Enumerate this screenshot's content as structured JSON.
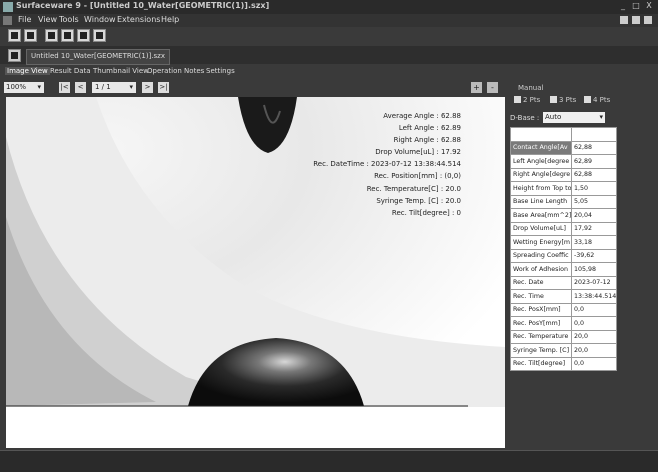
{
  "window": {
    "title": "Surfaceware 9 - [Untitled 10_Water[GEOMETRIC(1)].szx]",
    "min": "_",
    "max": "□",
    "close": "X"
  },
  "menu": [
    "File",
    "View",
    "Tools",
    "Window",
    "Extensions",
    "Help"
  ],
  "document_tab": "Untitled 10_Water[GEOMETRIC(1)].szx",
  "view_tabs": [
    "Image View",
    "Result Data",
    "Thumbnail View",
    "Operation Notes",
    "Settings"
  ],
  "nav": {
    "zoom": "100%",
    "first": "|<",
    "prev": "<",
    "page": "1 / 1",
    "next": ">",
    "last": ">|",
    "zoom_in": "+",
    "zoom_out": "-"
  },
  "overlay": [
    "Average Angle : 62.88",
    "Left Angle : 62.89",
    "Right Angle : 62.88",
    "Drop Volume[uL] : 17.92",
    "Rec. DateTime : 2023-07-12 13:38:44.514",
    "Rec. Position[mm] : (0,0)",
    "Rec. Temperature[C] : 20.0",
    "Syringe Temp.  [C] : 20.0",
    "Rec. Tilt[degree] : 0"
  ],
  "right_panel": {
    "manual_label": "Manual",
    "checkboxes": [
      "2 Pts",
      "3 Pts",
      "4 Pts"
    ],
    "dbase_label": "D-Base :",
    "dbase_value": "Auto",
    "results": [
      {
        "key": "",
        "value": ""
      },
      {
        "key": "Contact Angle[Av",
        "value": "62,88"
      },
      {
        "key": "Left Angle[degree",
        "value": "62,89"
      },
      {
        "key": "Right Angle[degre",
        "value": "62,88"
      },
      {
        "key": "Height from Top to",
        "value": "1,50"
      },
      {
        "key": "Base Line Length",
        "value": "5,05"
      },
      {
        "key": "Base Area[mm^2]",
        "value": "20,04"
      },
      {
        "key": "Drop Volume[uL]",
        "value": "17,92"
      },
      {
        "key": "Wetting Energy[m",
        "value": "33,18"
      },
      {
        "key": "Spreading Coeffic",
        "value": "-39,62"
      },
      {
        "key": "Work of Adhesion",
        "value": "105,98"
      },
      {
        "key": "Rec. Date",
        "value": "2023-07-12"
      },
      {
        "key": "Rec. Time",
        "value": "13:38:44.514"
      },
      {
        "key": "Rec. PosX[mm]",
        "value": "0,0"
      },
      {
        "key": "Rec. PosY[mm]",
        "value": "0,0"
      },
      {
        "key": "Rec. Temperature",
        "value": "20,0"
      },
      {
        "key": "Syringe Temp. [C]",
        "value": "20,0"
      },
      {
        "key": "Rec. Tilt[degree]",
        "value": "0,0"
      }
    ]
  }
}
